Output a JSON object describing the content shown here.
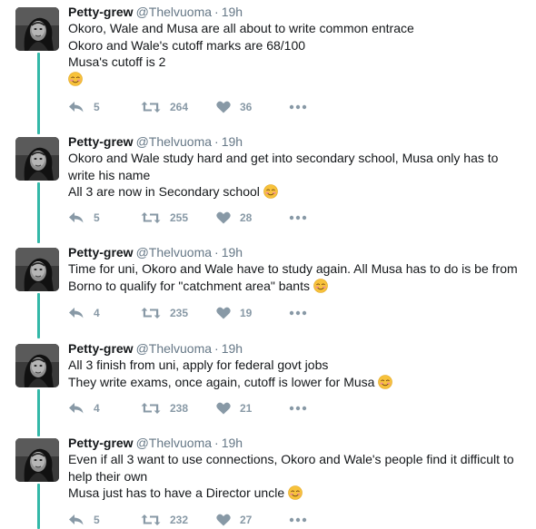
{
  "colors": {
    "thread_line": "#33b8a8",
    "name": "#14171a",
    "meta": "#657786",
    "action": "#8899a6"
  },
  "icons": {
    "reply": "reply-icon",
    "retweet": "retweet-icon",
    "like": "heart-icon",
    "more": "more-dots-icon",
    "emoji": "smiling-face-with-smiling-eyes-emoji"
  },
  "tweets": [
    {
      "name": "Petty-grew",
      "handle": "@Thelvuoma",
      "separator": "·",
      "time": "19h",
      "lines": [
        "Okoro, Wale and Musa are all about to write common entrace",
        "Okoro and Wale's cutoff marks are 68/100",
        "Musa's cutoff is 2",
        ""
      ],
      "replies": "5",
      "retweets": "264",
      "likes": "36"
    },
    {
      "name": "Petty-grew",
      "handle": "@Thelvuoma",
      "separator": "·",
      "time": "19h",
      "lines": [
        "Okoro and Wale study hard and get into secondary school, Musa only has to",
        "write his name",
        "All 3 are now in Secondary school"
      ],
      "replies": "5",
      "retweets": "255",
      "likes": "28"
    },
    {
      "name": "Petty-grew",
      "handle": "@Thelvuoma",
      "separator": "·",
      "time": "19h",
      "lines": [
        "Time for uni, Okoro and Wale have to study again. All Musa has to do is be from",
        "Borno to qualify for \"catchment area\" bants"
      ],
      "replies": "4",
      "retweets": "235",
      "likes": "19"
    },
    {
      "name": "Petty-grew",
      "handle": "@Thelvuoma",
      "separator": "·",
      "time": "19h",
      "lines": [
        "All 3 finish from uni, apply for federal govt jobs",
        "They write exams, once again, cutoff is lower for Musa"
      ],
      "replies": "4",
      "retweets": "238",
      "likes": "21"
    },
    {
      "name": "Petty-grew",
      "handle": "@Thelvuoma",
      "separator": "·",
      "time": "19h",
      "lines": [
        "Even if all 3 want to use connections, Okoro and Wale's people find it difficult to",
        "help their own",
        "Musa just has to have a Director uncle"
      ],
      "replies": "5",
      "retweets": "232",
      "likes": "27"
    }
  ]
}
